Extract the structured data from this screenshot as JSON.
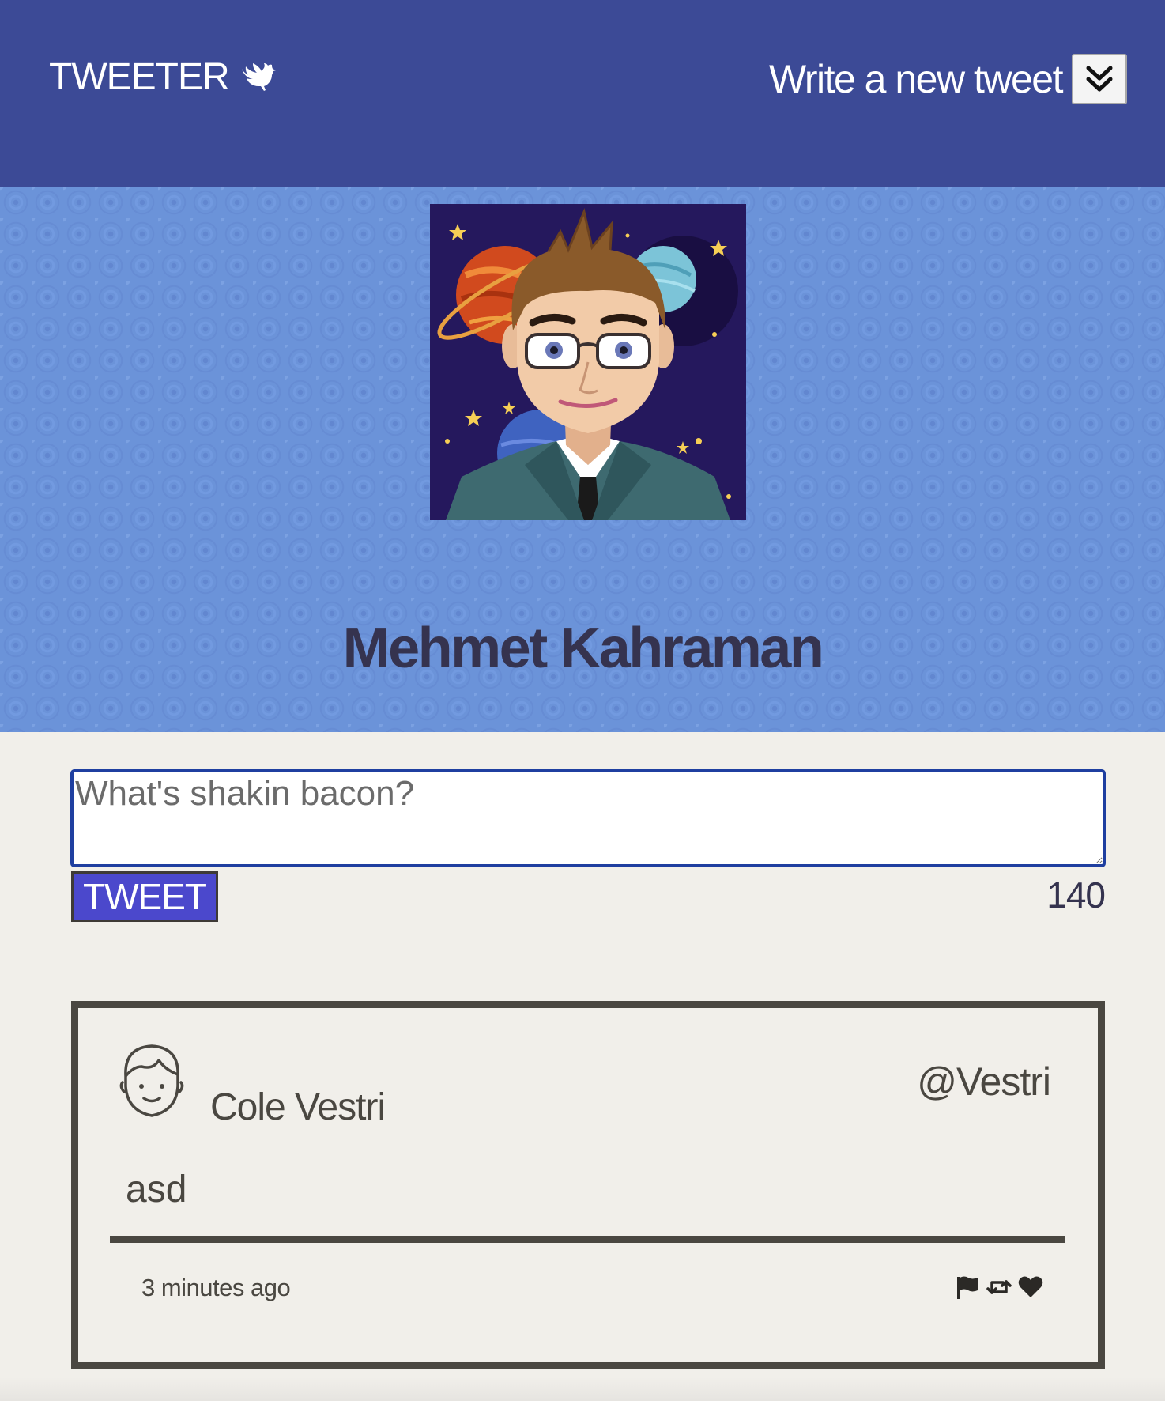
{
  "nav": {
    "brand": "TWEETER",
    "brand_icon": "dove-icon",
    "compose_label": "Write a new tweet",
    "compose_icon": "double-chevron-down-icon"
  },
  "profile": {
    "name": "Mehmet Kahraman",
    "avatar_icon": "user-avatar-illustration"
  },
  "compose": {
    "placeholder": "What's shakin bacon?",
    "value": "",
    "submit_label": "TWEET",
    "counter": "140"
  },
  "tweets": [
    {
      "avatar_icon": "face-outline-icon",
      "name": "Cole Vestri",
      "handle": "@Vestri",
      "content": "asd",
      "time": "3 minutes ago",
      "actions": [
        "flag-icon",
        "retweet-icon",
        "heart-icon"
      ]
    }
  ],
  "colors": {
    "nav_bg": "#3c4a96",
    "profile_bg": "#6b93d9",
    "page_bg": "#f1efea",
    "accent_button": "#4b48cc",
    "text_dark": "#35334f",
    "tweet_border": "#4a4741"
  }
}
